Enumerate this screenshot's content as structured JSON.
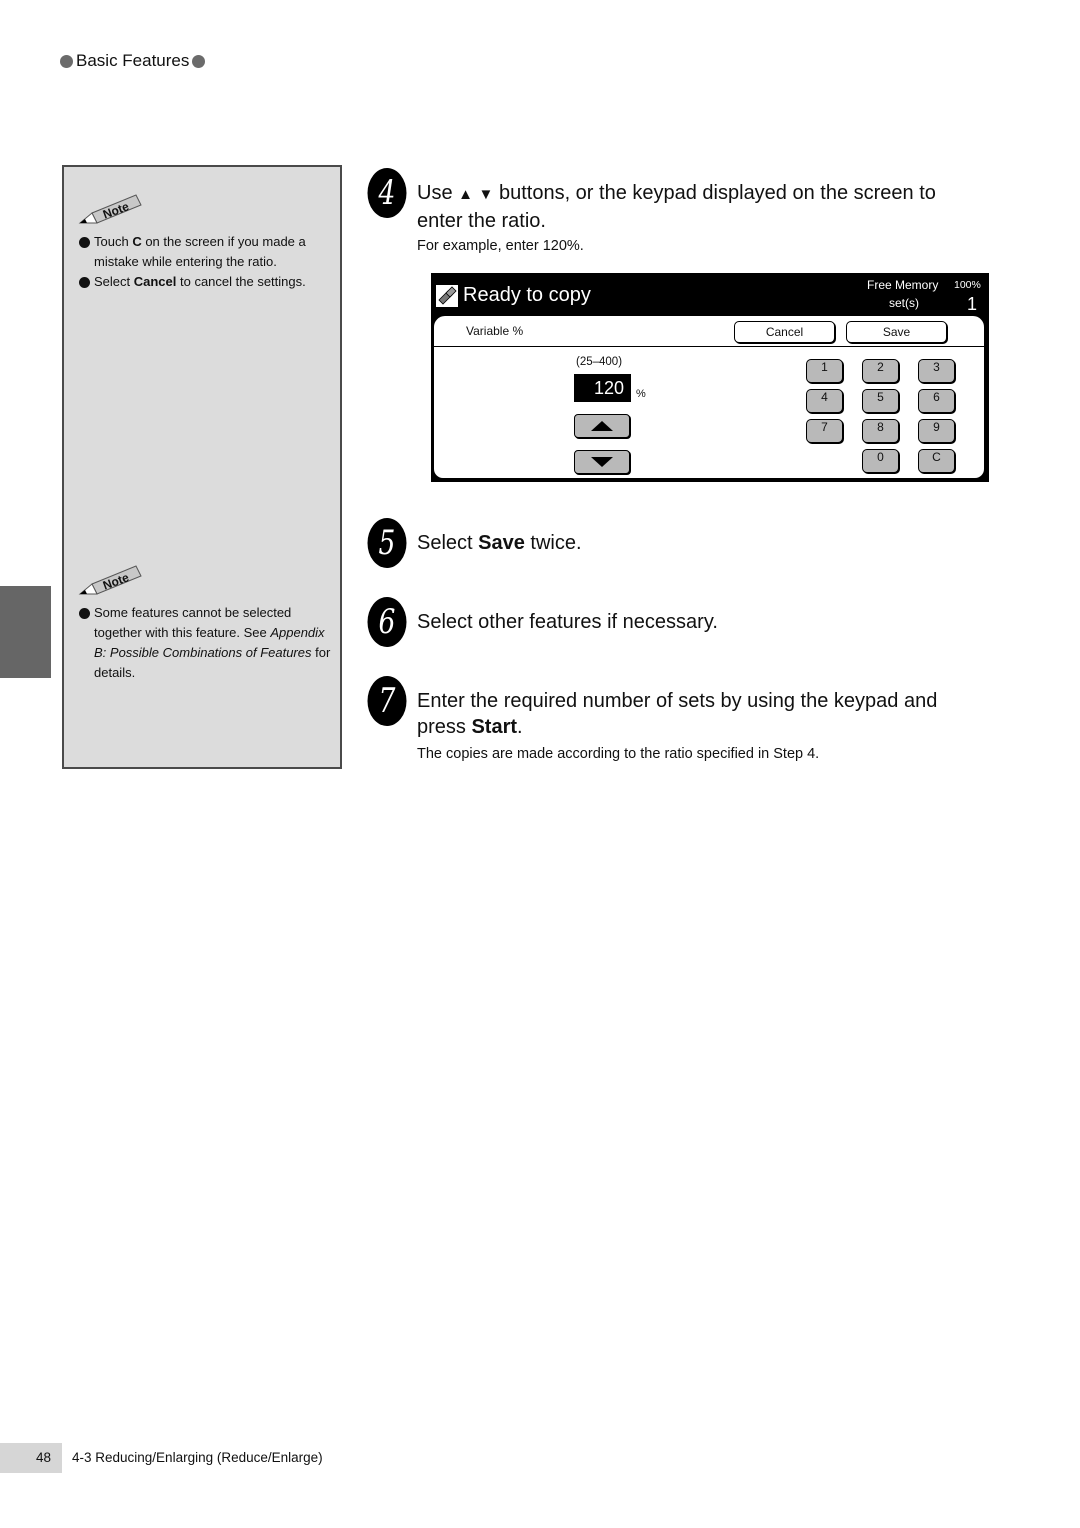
{
  "header": {
    "section": "Basic Features"
  },
  "notes": [
    {
      "badge": "Note",
      "items": [
        {
          "parts": [
            {
              "t": "Touch "
            },
            {
              "t": "C",
              "b": true
            },
            {
              "t": " on the screen if you made a mistake while entering the ratio."
            }
          ]
        },
        {
          "parts": [
            {
              "t": "Select "
            },
            {
              "t": "Cancel",
              "b": true
            },
            {
              "t": " to cancel the settings."
            }
          ]
        }
      ]
    },
    {
      "badge": "Note",
      "items": [
        {
          "parts": [
            {
              "t": "Some features cannot be selected together with this feature. See "
            },
            {
              "t": "Appendix B: Possible Combinations of Features",
              "i": true
            },
            {
              "t": " for details."
            }
          ]
        }
      ]
    }
  ],
  "steps": {
    "s4": {
      "num": "4",
      "t1": "Use ",
      "up": "▲",
      "down": "▼",
      "t2": " buttons, or the keypad displayed on the screen to enter the ratio.",
      "sub": "For example, enter 120%."
    },
    "s5": {
      "num": "5",
      "pre": "Select ",
      "bold": "Save",
      "post": " twice."
    },
    "s6": {
      "num": "6",
      "title": "Select other features if necessary."
    },
    "s7": {
      "num": "7",
      "pre": "Enter the required number of sets by using the keypad and press ",
      "bold": "Start",
      "post": ".",
      "sub": "The copies are made according to the ratio specified in Step 4."
    }
  },
  "screen": {
    "status": "Ready to copy",
    "free_memory_label": "Free Memory",
    "free_memory_value": "100%",
    "sets_label": "set(s)",
    "sets_value": "1",
    "panel_label": "Variable %",
    "cancel": "Cancel",
    "save": "Save",
    "range": "(25–400)",
    "value": "120",
    "unit": "%",
    "keys": [
      "1",
      "2",
      "3",
      "4",
      "5",
      "6",
      "7",
      "8",
      "9",
      "0",
      "C"
    ]
  },
  "footer": {
    "page": "48",
    "title": "4-3  Reducing/Enlarging (Reduce/Enlarge)"
  }
}
